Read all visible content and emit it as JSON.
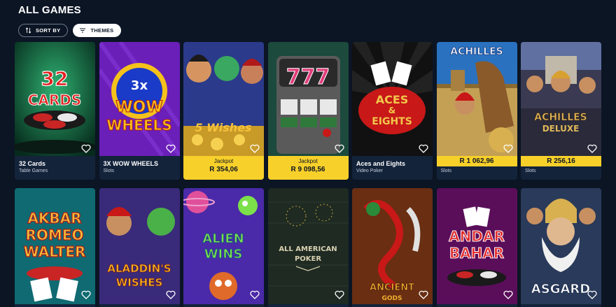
{
  "page": {
    "title": "ALL GAMES"
  },
  "filters": {
    "sort_label": "SORT BY",
    "themes_label": "THEMES"
  },
  "games_row1": [
    {
      "name": "32 Cards",
      "category": "Table Games",
      "logo": [
        "32",
        "CARDS"
      ],
      "colors": {
        "bg": "#0e5a3a",
        "accent": "#d92020"
      }
    },
    {
      "name": "3X WOW WHEELS",
      "category": "Slots",
      "logo": [
        "3x",
        "WOW",
        "WHEELS"
      ],
      "colors": {
        "bg": "#6a1fb8",
        "accent": "#f5c21b"
      }
    },
    {
      "name": "5 Wishes",
      "jackpot_label": "Jackpot",
      "jackpot_amount": "R 354,06",
      "logo": [
        "5 Wishes"
      ],
      "colors": {
        "bg": "#2b3a8a",
        "accent": "#f6c23a"
      }
    },
    {
      "name": "777",
      "jackpot_label": "Jackpot",
      "jackpot_amount": "R 9 098,56",
      "logo": [
        "777"
      ],
      "colors": {
        "bg": "#1c4a3c",
        "accent": "#e23c7a"
      }
    },
    {
      "name": "Aces and Eights",
      "category": "Video Poker",
      "logo": [
        "ACES",
        "&",
        "EIGHTS"
      ],
      "colors": {
        "bg": "#111111",
        "accent": "#c81818"
      }
    },
    {
      "name": "Achilles",
      "amount": "R 1 062,96",
      "category": "Slots",
      "logo": [
        "ACHILLES"
      ],
      "colors": {
        "bg": "#2a72c0",
        "accent": "#c4a055"
      }
    },
    {
      "name": "Achilles Deluxe",
      "amount": "R 256,16",
      "category": "Slots",
      "logo": [
        "ACHILLES",
        "DELUXE"
      ],
      "colors": {
        "bg": "#3a3a52",
        "accent": "#e0b858"
      }
    }
  ],
  "games_row2": [
    {
      "name": "Akbar Romeo Walter",
      "logo": [
        "AKBAR",
        "ROMEO",
        "WALTER"
      ],
      "colors": {
        "bg": "#0f6a72",
        "accent": "#e23030"
      }
    },
    {
      "name": "Aladdin's Wishes",
      "logo": [
        "ALADDIN'S",
        "WISHES"
      ],
      "colors": {
        "bg": "#3a2a7a",
        "accent": "#f4b81e"
      }
    },
    {
      "name": "Alien Wins",
      "logo": [
        "ALIEN",
        "WINS"
      ],
      "colors": {
        "bg": "#4a2aa8",
        "accent": "#7be04a"
      }
    },
    {
      "name": "All American Poker",
      "logo": [
        "ALL AMERICAN",
        "POKER"
      ],
      "colors": {
        "bg": "#1e2a22",
        "accent": "#d8d0b0"
      }
    },
    {
      "name": "Ancient Gods",
      "logo": [
        "ANCIENT",
        "GODS"
      ],
      "colors": {
        "bg": "#6a2e12",
        "accent": "#f0b030"
      }
    },
    {
      "name": "Andar Bahar",
      "logo": [
        "ANDAR",
        "BAHAR"
      ],
      "colors": {
        "bg": "#5a0e5a",
        "accent": "#e22a2a"
      }
    },
    {
      "name": "Asgard",
      "logo": [
        "ASGARD"
      ],
      "colors": {
        "bg": "#2a3a5a",
        "accent": "#f2d060"
      }
    }
  ]
}
